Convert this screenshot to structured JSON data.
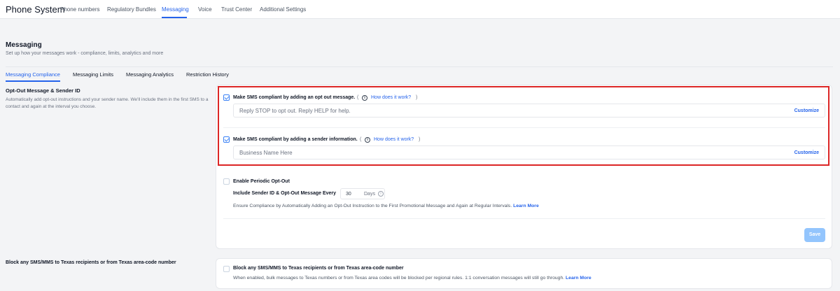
{
  "app": {
    "title": "Phone System"
  },
  "nav": {
    "tabs": [
      "Phone numbers",
      "Regulatory Bundles",
      "Messaging",
      "Voice",
      "Trust Center",
      "Additional Settings"
    ],
    "active_tab": "Messaging"
  },
  "page": {
    "title": "Messaging",
    "subtitle": "Set up how your messages work - compliance, limits, analytics and more"
  },
  "subtabs": {
    "items": [
      "Messaging Compliance",
      "Messaging Limits",
      "Messaging Analytics",
      "Restriction History"
    ],
    "active": "Messaging Compliance"
  },
  "optout_section": {
    "title": "Opt-Out Message & Sender ID",
    "description": "Automatically add opt-out instructions and your sender name. We'll include them in the first SMS to a contact and again at the interval you choose."
  },
  "optout_message": {
    "checked": true,
    "label": "Make SMS compliant by adding an opt out message.",
    "paren_open": "(",
    "paren_close": ")",
    "info_glyph": "i",
    "help_link": "How does it work?",
    "input_value": "Reply STOP to opt out. Reply HELP for help.",
    "customize_label": "Customize"
  },
  "sender_info": {
    "checked": true,
    "label": "Make SMS compliant by adding a sender information.",
    "paren_open": "(",
    "paren_close": ")",
    "info_glyph": "i",
    "help_link": "How does it work?",
    "input_placeholder": "Business Name Here",
    "customize_label": "Customize"
  },
  "periodic_optout": {
    "checked": false,
    "label": "Enable Periodic Opt-Out",
    "interval_label": "Include Sender ID & Opt-Out Message Every",
    "interval_value": "30",
    "interval_unit": "Days",
    "info_glyph": "i",
    "description": "Ensure Compliance by Automatically Adding an Opt-Out Instruction to the First Promotional Message and Again at Regular Intervals.",
    "learn_more": "Learn More"
  },
  "save_button": {
    "label": "Save",
    "enabled": false
  },
  "texas_section": {
    "title": "Block any SMS/MMS to Texas recipients or from Texas area-code number",
    "checkbox_checked": false,
    "checkbox_label": "Block any SMS/MMS to Texas recipients or from Texas area-code number",
    "description": "When enabled, bulk messages to Texas numbers or from Texas area codes will be blocked per regional rules. 1:1 conversation messages will still go through.",
    "learn_more": "Learn More"
  },
  "colors": {
    "accent": "#2563eb",
    "highlight_border": "#dc2626",
    "save_disabled": "#93c5fd",
    "page_bg": "#f3f4f6"
  },
  "icons": [
    "info-icon",
    "checkbox-checked-icon",
    "checkbox-unchecked-icon"
  ]
}
